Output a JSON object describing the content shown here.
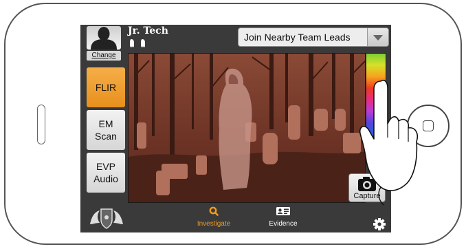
{
  "profile": {
    "role_title": "Jr. Tech",
    "change_label": "Change"
  },
  "team_select": {
    "selected": "Join Nearby Team Leads"
  },
  "modes": [
    {
      "label": "FLIR",
      "selected": true
    },
    {
      "label": "EM\nScan",
      "selected": false
    },
    {
      "label": "EVP\nAudio",
      "selected": false
    }
  ],
  "capture": {
    "label": "Capture"
  },
  "tabs": [
    {
      "label": "Investigate",
      "active": true
    },
    {
      "label": "Evidence",
      "active": false
    }
  ],
  "colors": {
    "accent": "#f39a1e",
    "active_mode": "#eea03a",
    "screen_bg": "#3a3a3a",
    "viewfinder_tint": "#7a3a2a"
  },
  "icons": [
    "person-silhouette-icon",
    "ghost-rank-icon",
    "chevron-down-icon",
    "camera-icon",
    "search-icon",
    "evidence-card-icon",
    "gear-icon",
    "crest-logo-icon",
    "hand-gesture-icon",
    "home-button-icon"
  ]
}
